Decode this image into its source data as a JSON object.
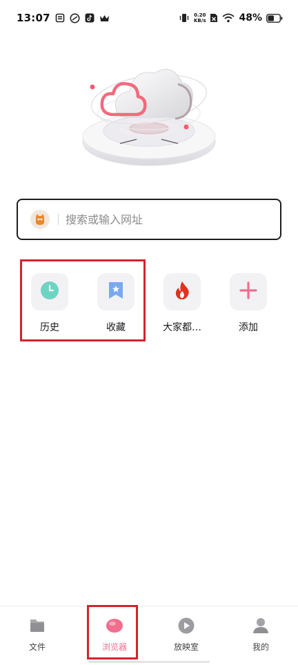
{
  "status_bar": {
    "time": "13:07",
    "net_speed_value": "0.20",
    "net_speed_unit": "KB/s",
    "battery_percent": "48%"
  },
  "search": {
    "placeholder": "搜索或输入网址",
    "value": ""
  },
  "shortcuts": [
    {
      "label": "历史",
      "icon": "clock-icon",
      "color": "#6fd3c3"
    },
    {
      "label": "收藏",
      "icon": "bookmark-icon",
      "color": "#7aa8f2"
    },
    {
      "label": "大家都…",
      "icon": "fire-icon",
      "color": "#e0321f"
    },
    {
      "label": "添加",
      "icon": "plus-icon",
      "color": "#f06e8e"
    }
  ],
  "bottom_nav": {
    "items": [
      {
        "label": "文件",
        "icon": "file-icon",
        "active": false
      },
      {
        "label": "浏览器",
        "icon": "browser-icon",
        "active": true
      },
      {
        "label": "放映室",
        "icon": "play-icon",
        "active": false
      },
      {
        "label": "我的",
        "icon": "profile-icon",
        "active": false
      }
    ]
  },
  "colors": {
    "accent": "#f06e8e",
    "highlight": "#d5222d"
  }
}
